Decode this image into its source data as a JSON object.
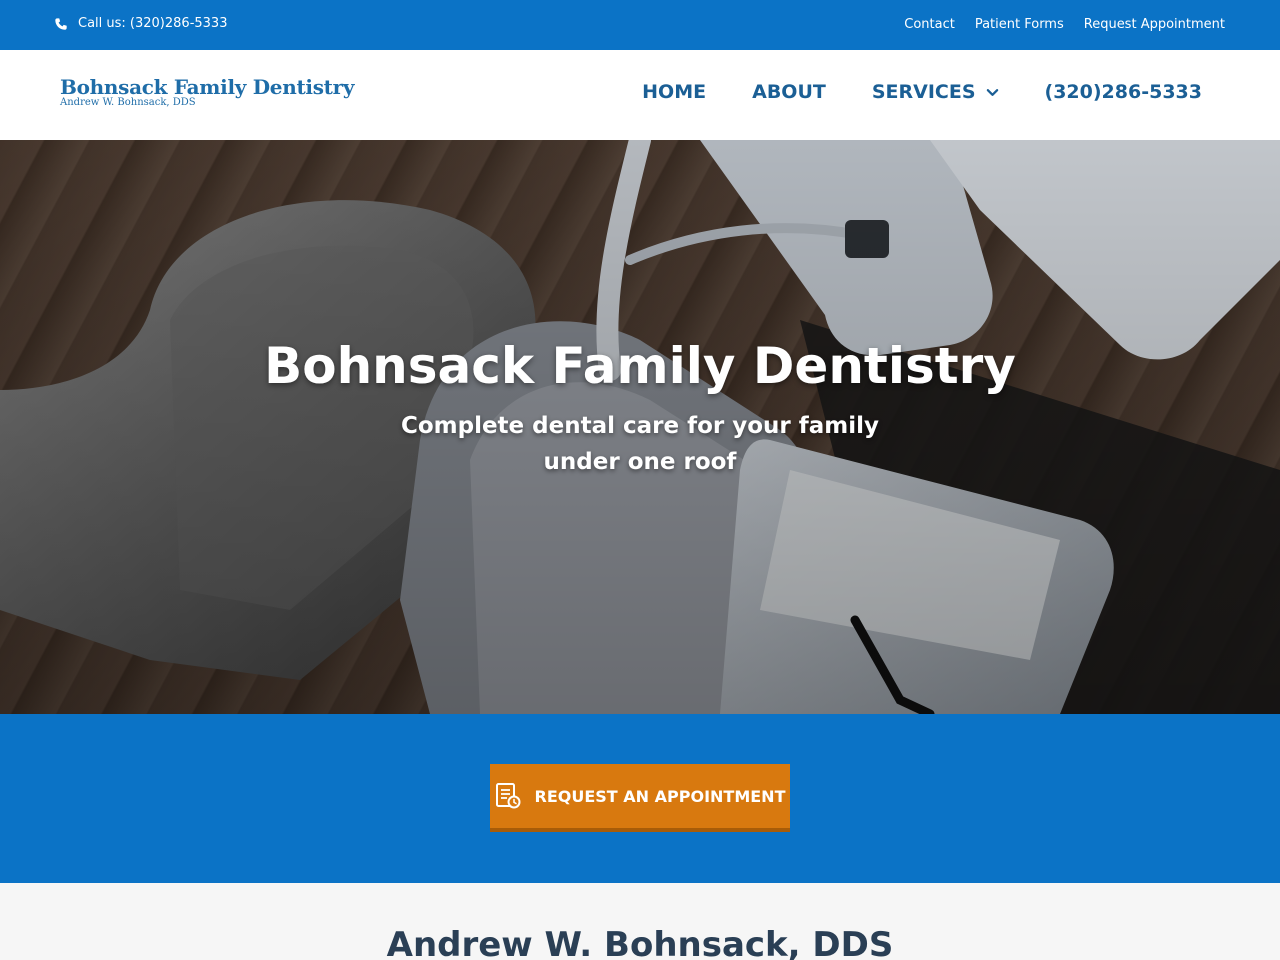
{
  "topbar": {
    "call_text": "Call us: (320)286-5333",
    "links": [
      "Contact",
      "Patient Forms",
      "Request Appointment"
    ]
  },
  "header": {
    "logo_main": "Bohnsack Family Dentistry",
    "logo_sub": "Andrew W. Bohnsack, DDS",
    "nav": {
      "home": "HOME",
      "about": "ABOUT",
      "services": "SERVICES",
      "phone": "(320)286-5333"
    }
  },
  "hero": {
    "title": "Bohnsack Family Dentistry",
    "subtitle": "Complete dental care for your family under one roof"
  },
  "cta": {
    "label": "REQUEST AN APPOINTMENT"
  },
  "about": {
    "title": "Andrew W. Bohnsack, DDS"
  },
  "colors": {
    "brand_blue": "#0b73c6",
    "nav_blue": "#1b5f95",
    "cta_orange": "#d8790f",
    "heading_dark": "#2a3f55"
  },
  "icons": {
    "phone": "phone-icon",
    "services_dropdown": "chevron-down-icon",
    "appointment": "form-clock-icon"
  }
}
